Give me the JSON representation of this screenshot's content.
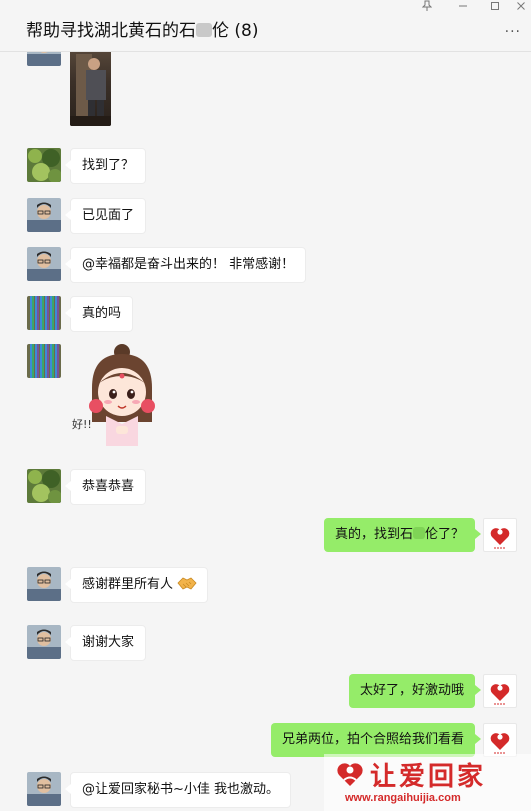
{
  "window": {
    "title": "帮助寻找湖北黄石的石",
    "title_masked_suffix": "伦",
    "member_count": "(8)",
    "pin_icon": "pin-icon",
    "minimize_icon": "minimize-icon",
    "maximize_icon": "maximize-icon",
    "close_icon": "close-icon",
    "more_icon": "more-icon"
  },
  "messages": [
    {
      "side": "in",
      "type": "photo",
      "avatar": "avatar-man-glasses"
    },
    {
      "side": "in",
      "type": "text",
      "avatar": "avatar-green-plants",
      "text": "找到了？"
    },
    {
      "side": "in",
      "type": "text",
      "avatar": "avatar-man-glasses",
      "text": "已见面了"
    },
    {
      "side": "in",
      "type": "text",
      "avatar": "avatar-man-glasses",
      "text": "@幸福都是奋斗出来的！ 非常感谢！"
    },
    {
      "side": "in",
      "type": "text",
      "avatar": "avatar-colorful-threads",
      "text": "真的吗"
    },
    {
      "side": "in",
      "type": "sticker",
      "avatar": "avatar-colorful-threads",
      "sticker_text": "好!!"
    },
    {
      "side": "in",
      "type": "text",
      "avatar": "avatar-green-plants",
      "text": "恭喜恭喜"
    },
    {
      "side": "out",
      "type": "text",
      "avatar": "avatar-rangai-logo",
      "text_before": "真的，找到石",
      "text_after": "伦了？"
    },
    {
      "side": "in",
      "type": "text",
      "avatar": "avatar-man-glasses",
      "text": "感谢群里所有人",
      "emoji": "handshake-emoji"
    },
    {
      "side": "in",
      "type": "text",
      "avatar": "avatar-man-glasses",
      "text": "谢谢大家"
    },
    {
      "side": "out",
      "type": "text",
      "avatar": "avatar-rangai-logo",
      "text": "太好了，好激动哦"
    },
    {
      "side": "out",
      "type": "text",
      "avatar": "avatar-rangai-logo",
      "text": "兄弟两位，拍个合照给我们看看"
    },
    {
      "side": "in",
      "type": "text",
      "avatar": "avatar-man-glasses",
      "text": "@让爱回家秘书~小佳 我也激动。"
    }
  ],
  "watermark": {
    "brand": "让爱回家",
    "url": "www.rangaihuijia.com",
    "brand_color": "#d42a2a"
  },
  "colors": {
    "outgoing_bubble": "#95ec69",
    "incoming_bubble": "#ffffff",
    "background": "#f5f5f5"
  }
}
